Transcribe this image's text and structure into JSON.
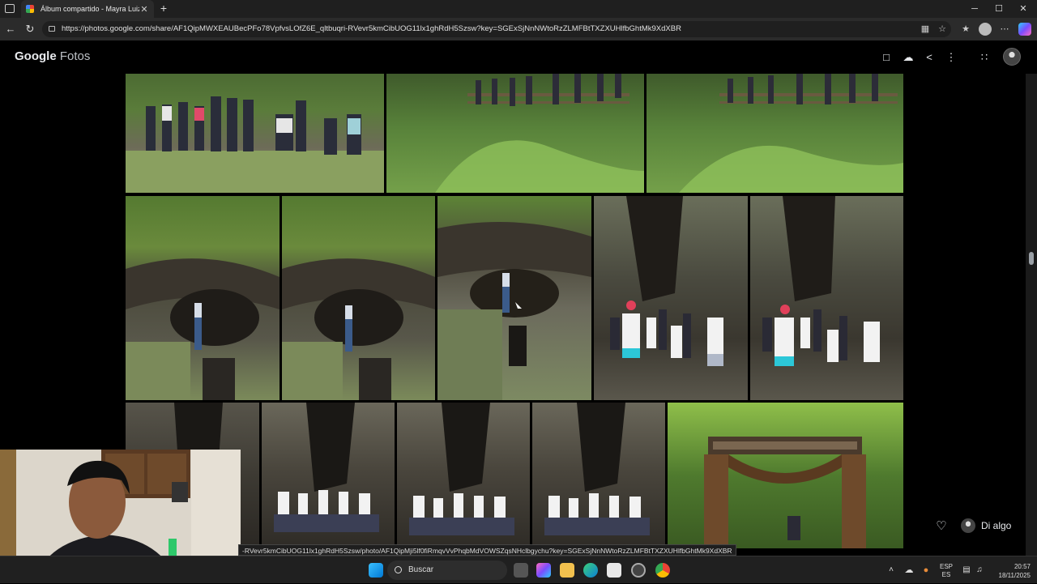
{
  "browser": {
    "tab_title": "Álbum compartido - Mayra Luiza",
    "tab_close": "✕",
    "new_tab": "+",
    "url": "https://photos.google.com/share/AF1QipMWXEAUBecPFo78VpfvsLOfZ6E_qltbuqri-RVevr5kmCibUOG11lx1ghRdH5Szsw?key=SGExSjNnNWtoRzZLMFBtTXZXUHlfbGhtMk9XdXBR",
    "window_controls": {
      "minimize": "─",
      "maximize": "☐",
      "close": "✕"
    }
  },
  "app": {
    "brand": "Google",
    "product": "Fotos"
  },
  "footer": {
    "comment_placeholder": "Di algo",
    "status_link": "-RVevr5kmCibUOG11lx1ghRdH5Szsw/photo/AF1QipMji5lf0fiRmqvVvPhqbMdVOWSZqsNHclbgychu?key=SGExSjNnNWtoRzZLMFBtTXZXUHlfbGhtMk9XdXBR"
  },
  "taskbar": {
    "search_label": "Buscar",
    "lang_top": "ESP",
    "lang_bottom": "ES",
    "time": "20:57",
    "date": "18/11/2025"
  },
  "colors": {
    "background": "#000000",
    "foliage": "#4f7a2e",
    "rock": "#6b6a5c",
    "cave_shadow": "#2a2723",
    "sign_wood": "#6e4a2b"
  },
  "photos": [
    {
      "scene": "group-on-rock-ledge"
    },
    {
      "scene": "people-on-railing-path"
    },
    {
      "scene": "people-on-railing-path"
    },
    {
      "scene": "person-in-cave"
    },
    {
      "scene": "person-in-cave"
    },
    {
      "scene": "person-in-cave-close"
    },
    {
      "scene": "group-at-cave-entrance"
    },
    {
      "scene": "group-at-cave-entrance"
    },
    {
      "scene": "cave-dark-wall"
    },
    {
      "scene": "group-inside-cave"
    },
    {
      "scene": "group-inside-cave"
    },
    {
      "scene": "group-inside-cave"
    },
    {
      "scene": "park-entrance-sign"
    }
  ]
}
